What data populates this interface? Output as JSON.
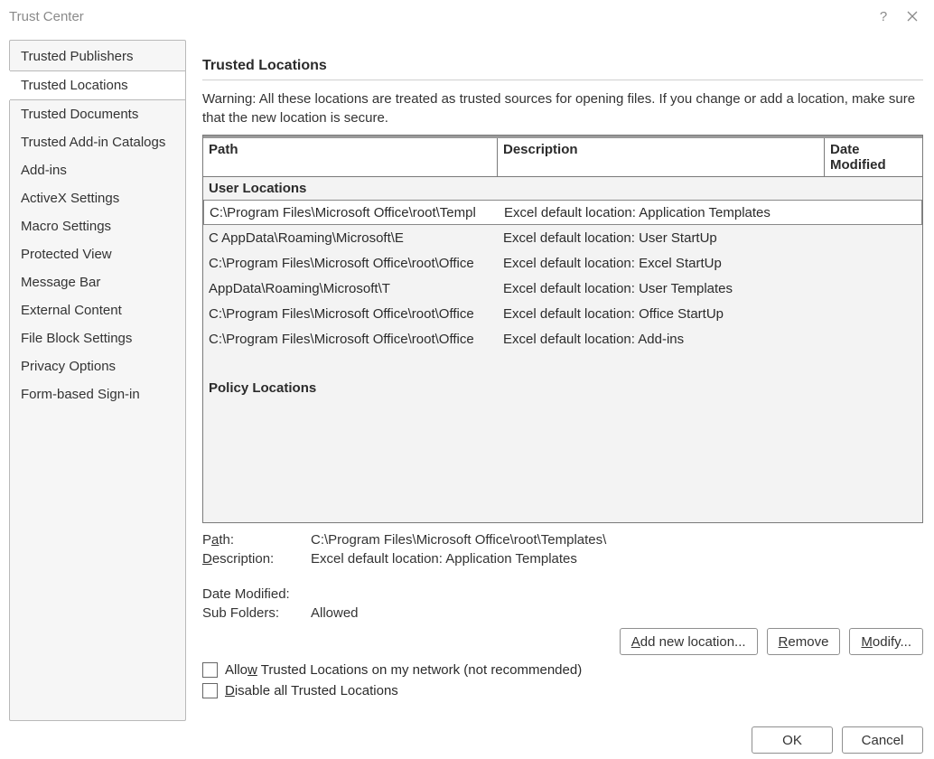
{
  "window": {
    "title": "Trust Center",
    "help_tooltip": "?",
    "close_tooltip": "Close"
  },
  "nav": {
    "items": [
      "Trusted Publishers",
      "Trusted Locations",
      "Trusted Documents",
      "Trusted Add-in Catalogs",
      "Add-ins",
      "ActiveX Settings",
      "Macro Settings",
      "Protected View",
      "Message Bar",
      "External Content",
      "File Block Settings",
      "Privacy Options",
      "Form-based Sign-in"
    ],
    "selected_index": 1
  },
  "panel": {
    "heading": "Trusted Locations",
    "warning": "Warning: All these locations are treated as trusted sources for opening files.  If you change or add a location, make sure that the new location is secure.",
    "columns": {
      "path": "Path",
      "description": "Description",
      "date": "Date Modified"
    },
    "groups": {
      "user": {
        "label": "User Locations",
        "rows": [
          {
            "path": "C:\\Program Files\\Microsoft Office\\root\\Templ",
            "desc": "Excel default location: Application Templates"
          },
          {
            "path": "C               AppData\\Roaming\\Microsoft\\E",
            "desc": "Excel default location: User StartUp"
          },
          {
            "path": "C:\\Program Files\\Microsoft Office\\root\\Office",
            "desc": "Excel default location: Excel StartUp"
          },
          {
            "path": "               AppData\\Roaming\\Microsoft\\T",
            "desc": "Excel default location: User Templates"
          },
          {
            "path": "C:\\Program Files\\Microsoft Office\\root\\Office",
            "desc": "Excel default location: Office StartUp"
          },
          {
            "path": "C:\\Program Files\\Microsoft Office\\root\\Office",
            "desc": "Excel default location: Add-ins"
          }
        ],
        "selected_index": 0
      },
      "policy": {
        "label": "Policy Locations"
      }
    },
    "details": {
      "path_label_pre": "P",
      "path_label_accel": "a",
      "path_label_post": "th:",
      "path_value": "C:\\Program Files\\Microsoft Office\\root\\Templates\\",
      "desc_label_pre": "",
      "desc_label_accel": "D",
      "desc_label_post": "escription:",
      "desc_value": "Excel default location: Application Templates",
      "date_label": "Date Modified:",
      "date_value": "",
      "sub_label": "Sub Folders:",
      "sub_value": "Allowed"
    },
    "buttons": {
      "add_pre": "",
      "add_accel": "A",
      "add_post": "dd new location...",
      "remove_pre": "",
      "remove_accel": "R",
      "remove_post": "emove",
      "modify_pre": "",
      "modify_accel": "M",
      "modify_post": "odify..."
    },
    "checkboxes": {
      "allow_network_pre": "Allo",
      "allow_network_accel": "w",
      "allow_network_post": " Trusted Locations on my network (not recommended)",
      "disable_all_pre": "",
      "disable_all_accel": "D",
      "disable_all_post": "isable all Trusted Locations"
    }
  },
  "footer": {
    "ok": "OK",
    "cancel": "Cancel"
  }
}
